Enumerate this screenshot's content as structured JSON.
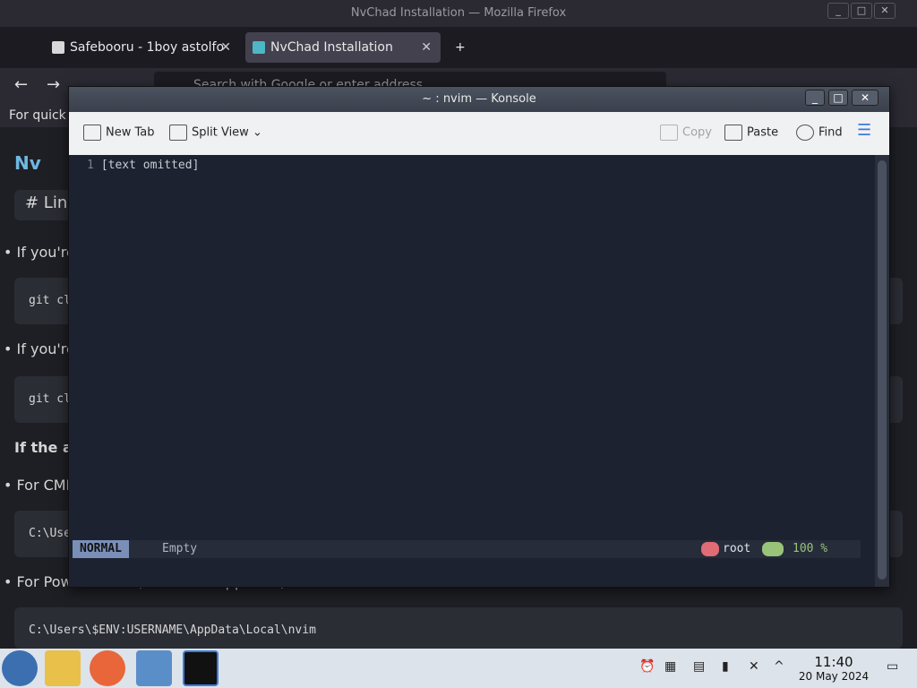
{
  "firefox": {
    "window_title": "NvChad Installation — Mozilla Firefox",
    "tabs": [
      {
        "label": "Safebooru - 1boy astolfo",
        "active": false
      },
      {
        "label": "NvChad Installation",
        "active": true
      }
    ],
    "new_tab": "+",
    "url_placeholder": "Search with Google or enter address",
    "bookmark_text": "For quick"
  },
  "page": {
    "logo": "Nv",
    "section_header": "# Lin",
    "bullets": [
      "If you're",
      "If you're",
      "For CMD",
      "For PowerShell - $ENV:LocalAppData\\nvim"
    ],
    "code_blocks": [
      "git cl",
      "git cl",
      "C:\\Use",
      "C:\\Users\\$ENV:USERNAME\\AppData\\Local\\nvim"
    ],
    "bold_line": "If the ab"
  },
  "konsole": {
    "title": "~ : nvim — Konsole",
    "toolbar": {
      "new_tab": "New Tab",
      "split_view": "Split View",
      "copy": "Copy",
      "paste": "Paste",
      "find": "Find"
    },
    "buffer": {
      "line_number": "1",
      "text": "[text omitted]",
      "cursor_char": " "
    },
    "statusline": {
      "mode": "NORMAL",
      "file": "Empty",
      "user": "root",
      "percent": "100 %"
    }
  },
  "taskbar": {
    "time": "11:40",
    "date": "20 May 2024"
  },
  "colors": {
    "terminal_bg": "#1d2230",
    "mode_bg": "#7a8fb8",
    "accent_red": "#e06c75",
    "accent_green": "#98c379"
  }
}
